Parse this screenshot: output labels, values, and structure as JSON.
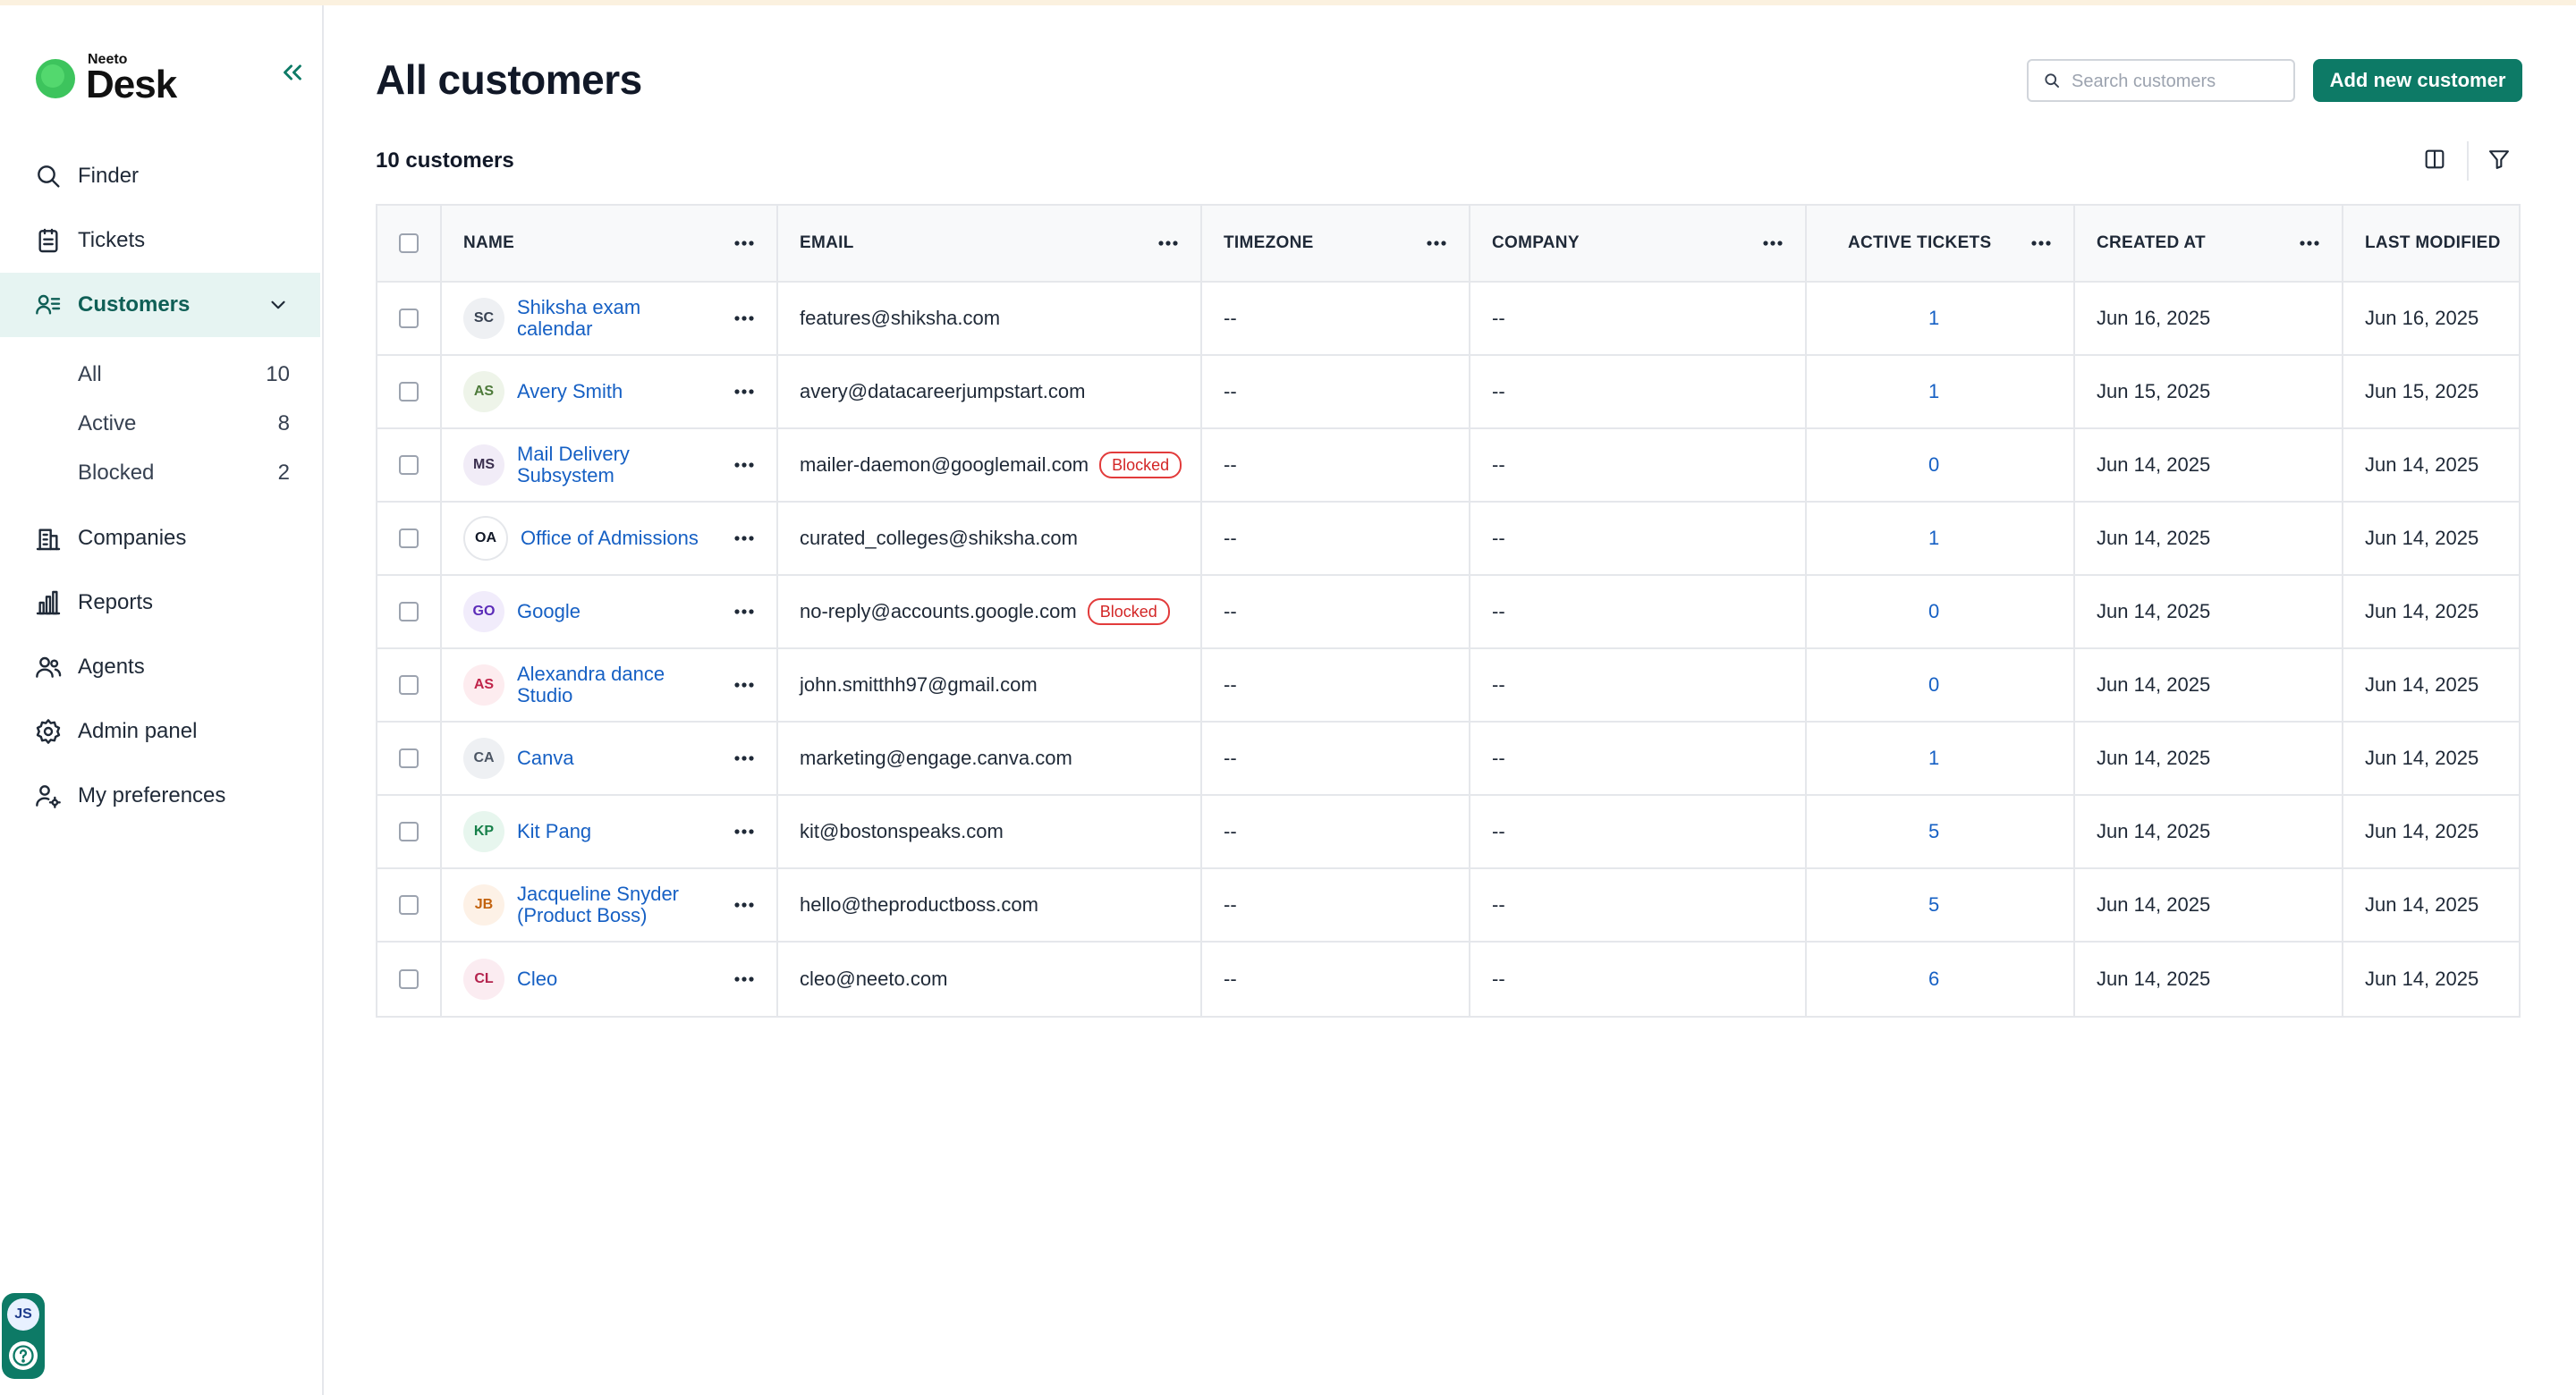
{
  "app": {
    "logo_small": "Neeto",
    "logo_main": "Desk"
  },
  "sidebar": {
    "items": [
      {
        "label": "Finder",
        "icon": "search-icon"
      },
      {
        "label": "Tickets",
        "icon": "tickets-icon"
      },
      {
        "label": "Customers",
        "icon": "customers-icon"
      },
      {
        "label": "Companies",
        "icon": "building-icon"
      },
      {
        "label": "Reports",
        "icon": "bar-chart-icon"
      },
      {
        "label": "Agents",
        "icon": "users-icon"
      },
      {
        "label": "Admin panel",
        "icon": "gear-icon"
      },
      {
        "label": "My preferences",
        "icon": "user-settings-icon"
      }
    ],
    "customer_filters": [
      {
        "label": "All",
        "count": "10"
      },
      {
        "label": "Active",
        "count": "8"
      },
      {
        "label": "Blocked",
        "count": "2"
      }
    ],
    "user_initials": "JS"
  },
  "header": {
    "title": "All customers",
    "search_placeholder": "Search customers",
    "add_button": "Add new customer",
    "count_label": "10 customers"
  },
  "table": {
    "columns": [
      "NAME",
      "EMAIL",
      "TIMEZONE",
      "COMPANY",
      "ACTIVE TICKETS",
      "CREATED AT",
      "LAST MODIFIED"
    ],
    "rows": [
      {
        "initials": "SC",
        "avatar_bg": "#eef0f3",
        "avatar_fg": "#374151",
        "name": "Shiksha exam calendar",
        "email": "features@shiksha.com",
        "blocked": false,
        "timezone": "--",
        "company": "--",
        "active_tickets": "1",
        "created_at": "Jun 16, 2025",
        "last_modified": "Jun 16, 2025"
      },
      {
        "initials": "AS",
        "avatar_bg": "#eef4e9",
        "avatar_fg": "#4d7a3a",
        "name": "Avery Smith",
        "email": "avery@datacareerjumpstart.com",
        "blocked": false,
        "timezone": "--",
        "company": "--",
        "active_tickets": "1",
        "created_at": "Jun 15, 2025",
        "last_modified": "Jun 15, 2025"
      },
      {
        "initials": "MS",
        "avatar_bg": "#f1ecf7",
        "avatar_fg": "#3b2f4f",
        "name": "Mail Delivery Subsystem",
        "email": "mailer-daemon@googlemail.com",
        "blocked": true,
        "timezone": "--",
        "company": "--",
        "active_tickets": "0",
        "created_at": "Jun 14, 2025",
        "last_modified": "Jun 14, 2025"
      },
      {
        "initials": "OA",
        "avatar_bg": "#ffffff",
        "avatar_fg": "#111827",
        "name": "Office of Admissions",
        "email": "curated_colleges@shiksha.com",
        "blocked": false,
        "timezone": "--",
        "company": "--",
        "active_tickets": "1",
        "created_at": "Jun 14, 2025",
        "last_modified": "Jun 14, 2025"
      },
      {
        "initials": "GO",
        "avatar_bg": "#f1ecfb",
        "avatar_fg": "#5b2bb8",
        "name": "Google",
        "email": "no-reply@accounts.google.com",
        "blocked": true,
        "timezone": "--",
        "company": "--",
        "active_tickets": "0",
        "created_at": "Jun 14, 2025",
        "last_modified": "Jun 14, 2025"
      },
      {
        "initials": "AS",
        "avatar_bg": "#fdecef",
        "avatar_fg": "#c0244a",
        "name": "Alexandra dance Studio",
        "email": "john.smitthh97@gmail.com",
        "blocked": false,
        "timezone": "--",
        "company": "--",
        "active_tickets": "0",
        "created_at": "Jun 14, 2025",
        "last_modified": "Jun 14, 2025"
      },
      {
        "initials": "CA",
        "avatar_bg": "#eef0f3",
        "avatar_fg": "#4b5563",
        "name": "Canva",
        "email": "marketing@engage.canva.com",
        "blocked": false,
        "timezone": "--",
        "company": "--",
        "active_tickets": "1",
        "created_at": "Jun 14, 2025",
        "last_modified": "Jun 14, 2025"
      },
      {
        "initials": "KP",
        "avatar_bg": "#e7f6ee",
        "avatar_fg": "#17804a",
        "name": "Kit Pang",
        "email": "kit@bostonspeaks.com",
        "blocked": false,
        "timezone": "--",
        "company": "--",
        "active_tickets": "5",
        "created_at": "Jun 14, 2025",
        "last_modified": "Jun 14, 2025"
      },
      {
        "initials": "JB",
        "avatar_bg": "#fdf1e6",
        "avatar_fg": "#c2620e",
        "name": "Jacqueline Snyder (Product Boss)",
        "email": "hello@theproductboss.com",
        "blocked": false,
        "timezone": "--",
        "company": "--",
        "active_tickets": "5",
        "created_at": "Jun 14, 2025",
        "last_modified": "Jun 14, 2025"
      },
      {
        "initials": "CL",
        "avatar_bg": "#fbecf1",
        "avatar_fg": "#b4234d",
        "name": "Cleo",
        "email": "cleo@neeto.com",
        "blocked": false,
        "timezone": "--",
        "company": "--",
        "active_tickets": "6",
        "created_at": "Jun 14, 2025",
        "last_modified": "Jun 14, 2025"
      }
    ],
    "blocked_label": "Blocked"
  },
  "colors": {
    "accent": "#0d7a66",
    "link": "#1660c4",
    "active_nav_bg": "#e6f4f2"
  }
}
